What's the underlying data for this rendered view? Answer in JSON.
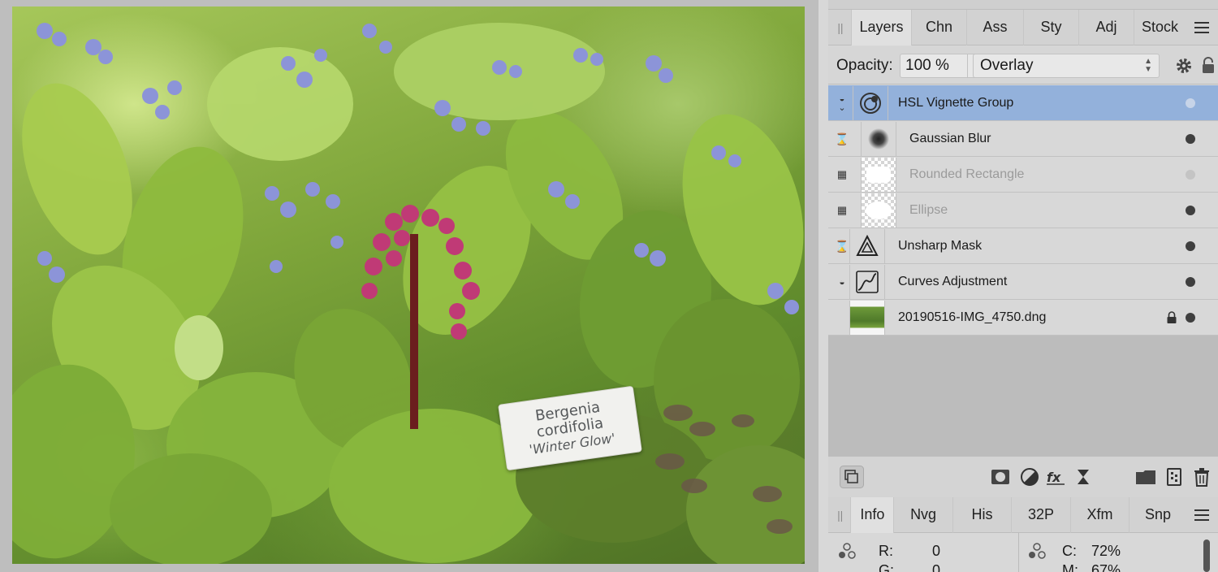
{
  "canvas": {
    "plant_label": {
      "line1": "Bergenia",
      "line2": "cordifolia",
      "line3": "'Winter Glow'"
    }
  },
  "layers_panel": {
    "tabs": [
      {
        "label": "Layers",
        "active": true
      },
      {
        "label": "Chn",
        "active": false
      },
      {
        "label": "Ass",
        "active": false
      },
      {
        "label": "Sty",
        "active": false
      },
      {
        "label": "Adj",
        "active": false
      },
      {
        "label": "Stock",
        "active": false
      }
    ],
    "opacity_label": "Opacity:",
    "opacity_value": "100 %",
    "blend_mode": "Overlay",
    "layers": [
      {
        "name": "HSL Vignette Group",
        "selected": true,
        "visible": false,
        "dimmed": false,
        "icon": "hsl-adjustment-icon"
      },
      {
        "name": "Gaussian Blur",
        "selected": false,
        "visible": true,
        "dimmed": false,
        "icon": "gaussian-blur-icon"
      },
      {
        "name": "Rounded Rectangle",
        "selected": false,
        "visible": false,
        "dimmed": true,
        "icon": "rounded-rectangle-icon"
      },
      {
        "name": "Ellipse",
        "selected": false,
        "visible": true,
        "dimmed": true,
        "icon": "ellipse-icon"
      },
      {
        "name": "Unsharp Mask",
        "selected": false,
        "visible": true,
        "dimmed": false,
        "icon": "unsharp-mask-icon"
      },
      {
        "name": "Curves Adjustment",
        "selected": false,
        "visible": true,
        "dimmed": false,
        "icon": "curves-icon"
      },
      {
        "name": "20190516-IMG_4750.dng",
        "selected": false,
        "visible": true,
        "dimmed": false,
        "locked": true,
        "icon": "image-thumbnail"
      }
    ]
  },
  "info_panel": {
    "tabs": [
      {
        "label": "Info",
        "active": true
      },
      {
        "label": "Nvg",
        "active": false
      },
      {
        "label": "His",
        "active": false
      },
      {
        "label": "32P",
        "active": false
      },
      {
        "label": "Xfm",
        "active": false
      },
      {
        "label": "Snp",
        "active": false
      }
    ],
    "r_label": "R:",
    "r_value": "0",
    "g_label": "G:",
    "g_value": "0",
    "c_label": "C:",
    "c_value": "72%",
    "m_label": "M:",
    "m_value": "67%"
  },
  "colors": {
    "selection": "#93b1db",
    "panel": "#d8d8d8"
  }
}
